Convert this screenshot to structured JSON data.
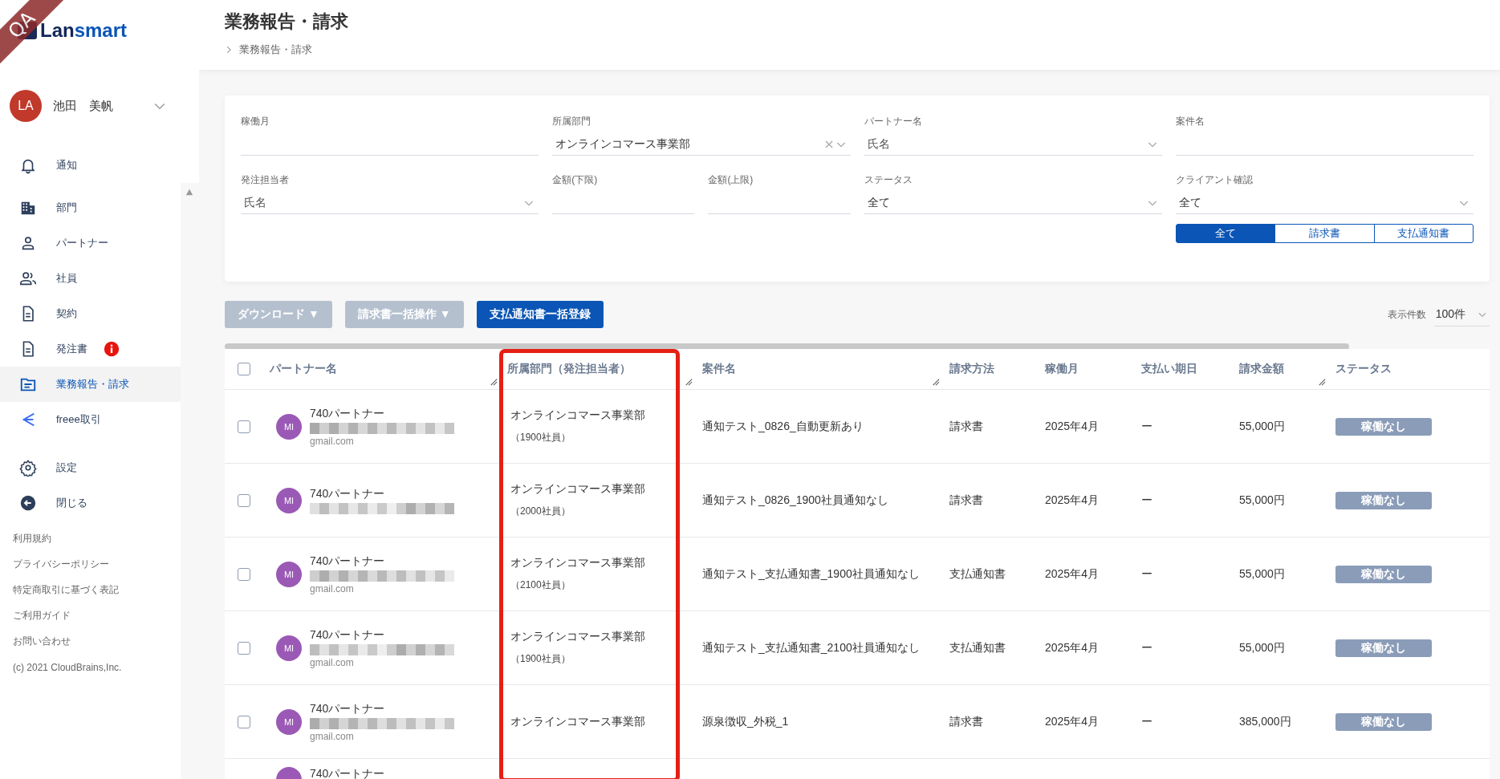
{
  "env_ribbon": "QA",
  "logo": {
    "prefix": "Lan",
    "suffix": "smart"
  },
  "user": {
    "initials": "LA",
    "name": "池田　美帆"
  },
  "sidebar": {
    "items": [
      {
        "label": "通知",
        "selected": false,
        "alert": false
      },
      {
        "label": "部門",
        "selected": false,
        "alert": false
      },
      {
        "label": "パートナー",
        "selected": false,
        "alert": false
      },
      {
        "label": "社員",
        "selected": false,
        "alert": false
      },
      {
        "label": "契約",
        "selected": false,
        "alert": false
      },
      {
        "label": "発注書",
        "selected": false,
        "alert": true
      },
      {
        "label": "業務報告・請求",
        "selected": true,
        "alert": false
      },
      {
        "label": "freee取引",
        "selected": false,
        "alert": false
      },
      {
        "label": "設定",
        "selected": false,
        "alert": false
      },
      {
        "label": "閉じる",
        "selected": false,
        "alert": false
      }
    ],
    "footer_links": [
      "利用規約",
      "プライバシーポリシー",
      "特定商取引に基づく表記",
      "ご利用ガイド",
      "お問い合わせ"
    ],
    "copyright": "(c) 2021 CloudBrains,Inc."
  },
  "header": {
    "title": "業務報告・請求",
    "breadcrumb": [
      "業務報告・請求"
    ]
  },
  "filters": {
    "rows": [
      [
        {
          "kind": "input",
          "label": "稼働月"
        },
        {
          "kind": "select",
          "label": "所属部門",
          "value": "オンラインコマース事業部",
          "clearable": true
        },
        {
          "kind": "select",
          "label": "パートナー名",
          "placeholder": "氏名",
          "clearable": false
        },
        {
          "kind": "input",
          "label": "案件名"
        }
      ],
      [
        {
          "kind": "select",
          "label": "発注担当者",
          "placeholder": "氏名",
          "clearable": false
        },
        {
          "kind": "pair",
          "fields": [
            {
              "kind": "input",
              "label": "金額(下限)"
            },
            {
              "kind": "input",
              "label": "金額(上限)"
            }
          ]
        },
        {
          "kind": "select",
          "label": "ステータス",
          "value": "全て",
          "clearable": false
        },
        {
          "kind": "select",
          "label": "クライアント確認",
          "value": "全て",
          "clearable": false
        }
      ]
    ],
    "doc_type_tabs": [
      {
        "label": "全て",
        "selected": true
      },
      {
        "label": "請求書",
        "selected": false
      },
      {
        "label": "支払通知書",
        "selected": false
      }
    ]
  },
  "actions": {
    "buttons": [
      {
        "label": "ダウンロード ▼",
        "disabled": true
      },
      {
        "label": "請求書一括操作 ▼",
        "disabled": true
      },
      {
        "label": "支払通知書一括登録",
        "disabled": false
      }
    ],
    "page_size": {
      "label": "表示件数",
      "value": "100件"
    }
  },
  "table": {
    "select_all_checked": false,
    "columns": [
      {
        "label": "パートナー名",
        "resizable": true,
        "highlighted": false
      },
      {
        "label": "所属部門（発注担当者）",
        "resizable": true,
        "highlighted": true
      },
      {
        "label": "案件名",
        "resizable": true,
        "highlighted": false
      },
      {
        "label": "請求方法",
        "resizable": false,
        "highlighted": false
      },
      {
        "label": "稼働月",
        "resizable": false,
        "highlighted": false
      },
      {
        "label": "支払い期日",
        "resizable": false,
        "highlighted": false
      },
      {
        "label": "請求金額",
        "resizable": true,
        "highlighted": false
      },
      {
        "label": "ステータス",
        "resizable": false,
        "highlighted": false
      }
    ],
    "rows": [
      {
        "checked": false,
        "avatar": "MI",
        "partner": "740パートナー",
        "email_domain": "gmail.com",
        "department": "オンラインコマース事業部",
        "orderer": "（1900社員）",
        "project": "通知テスト_0826_自動更新あり",
        "billing_method": "請求書",
        "month": "2025年4月",
        "due_date": "ー",
        "amount": "55,000円",
        "status": "稼働なし"
      },
      {
        "checked": false,
        "avatar": "MI",
        "partner": "740パートナー",
        "department": "オンラインコマース事業部",
        "orderer": "（2000社員）",
        "project": "通知テスト_0826_1900社員通知なし",
        "billing_method": "請求書",
        "month": "2025年4月",
        "due_date": "ー",
        "amount": "55,000円",
        "status": "稼働なし"
      },
      {
        "checked": false,
        "avatar": "MI",
        "partner": "740パートナー",
        "email_domain": "gmail.com",
        "department": "オンラインコマース事業部",
        "orderer": "（2100社員）",
        "project": "通知テスト_支払通知書_1900社員通知なし",
        "billing_method": "支払通知書",
        "month": "2025年4月",
        "due_date": "ー",
        "amount": "55,000円",
        "status": "稼働なし"
      },
      {
        "checked": false,
        "avatar": "MI",
        "partner": "740パートナー",
        "email_domain": "gmail.com",
        "department": "オンラインコマース事業部",
        "orderer": "（1900社員）",
        "project": "通知テスト_支払通知書_2100社員通知なし",
        "billing_method": "支払通知書",
        "month": "2025年4月",
        "due_date": "ー",
        "amount": "55,000円",
        "status": "稼働なし"
      },
      {
        "checked": false,
        "avatar": "MI",
        "partner": "740パートナー",
        "email_domain": "gmail.com",
        "department": "オンラインコマース事業部",
        "project": "源泉徴収_外税_1",
        "billing_method": "請求書",
        "month": "2025年4月",
        "due_date": "ー",
        "amount": "385,000円",
        "status": "稼働なし"
      },
      {
        "partner": "740パートナー"
      }
    ]
  }
}
